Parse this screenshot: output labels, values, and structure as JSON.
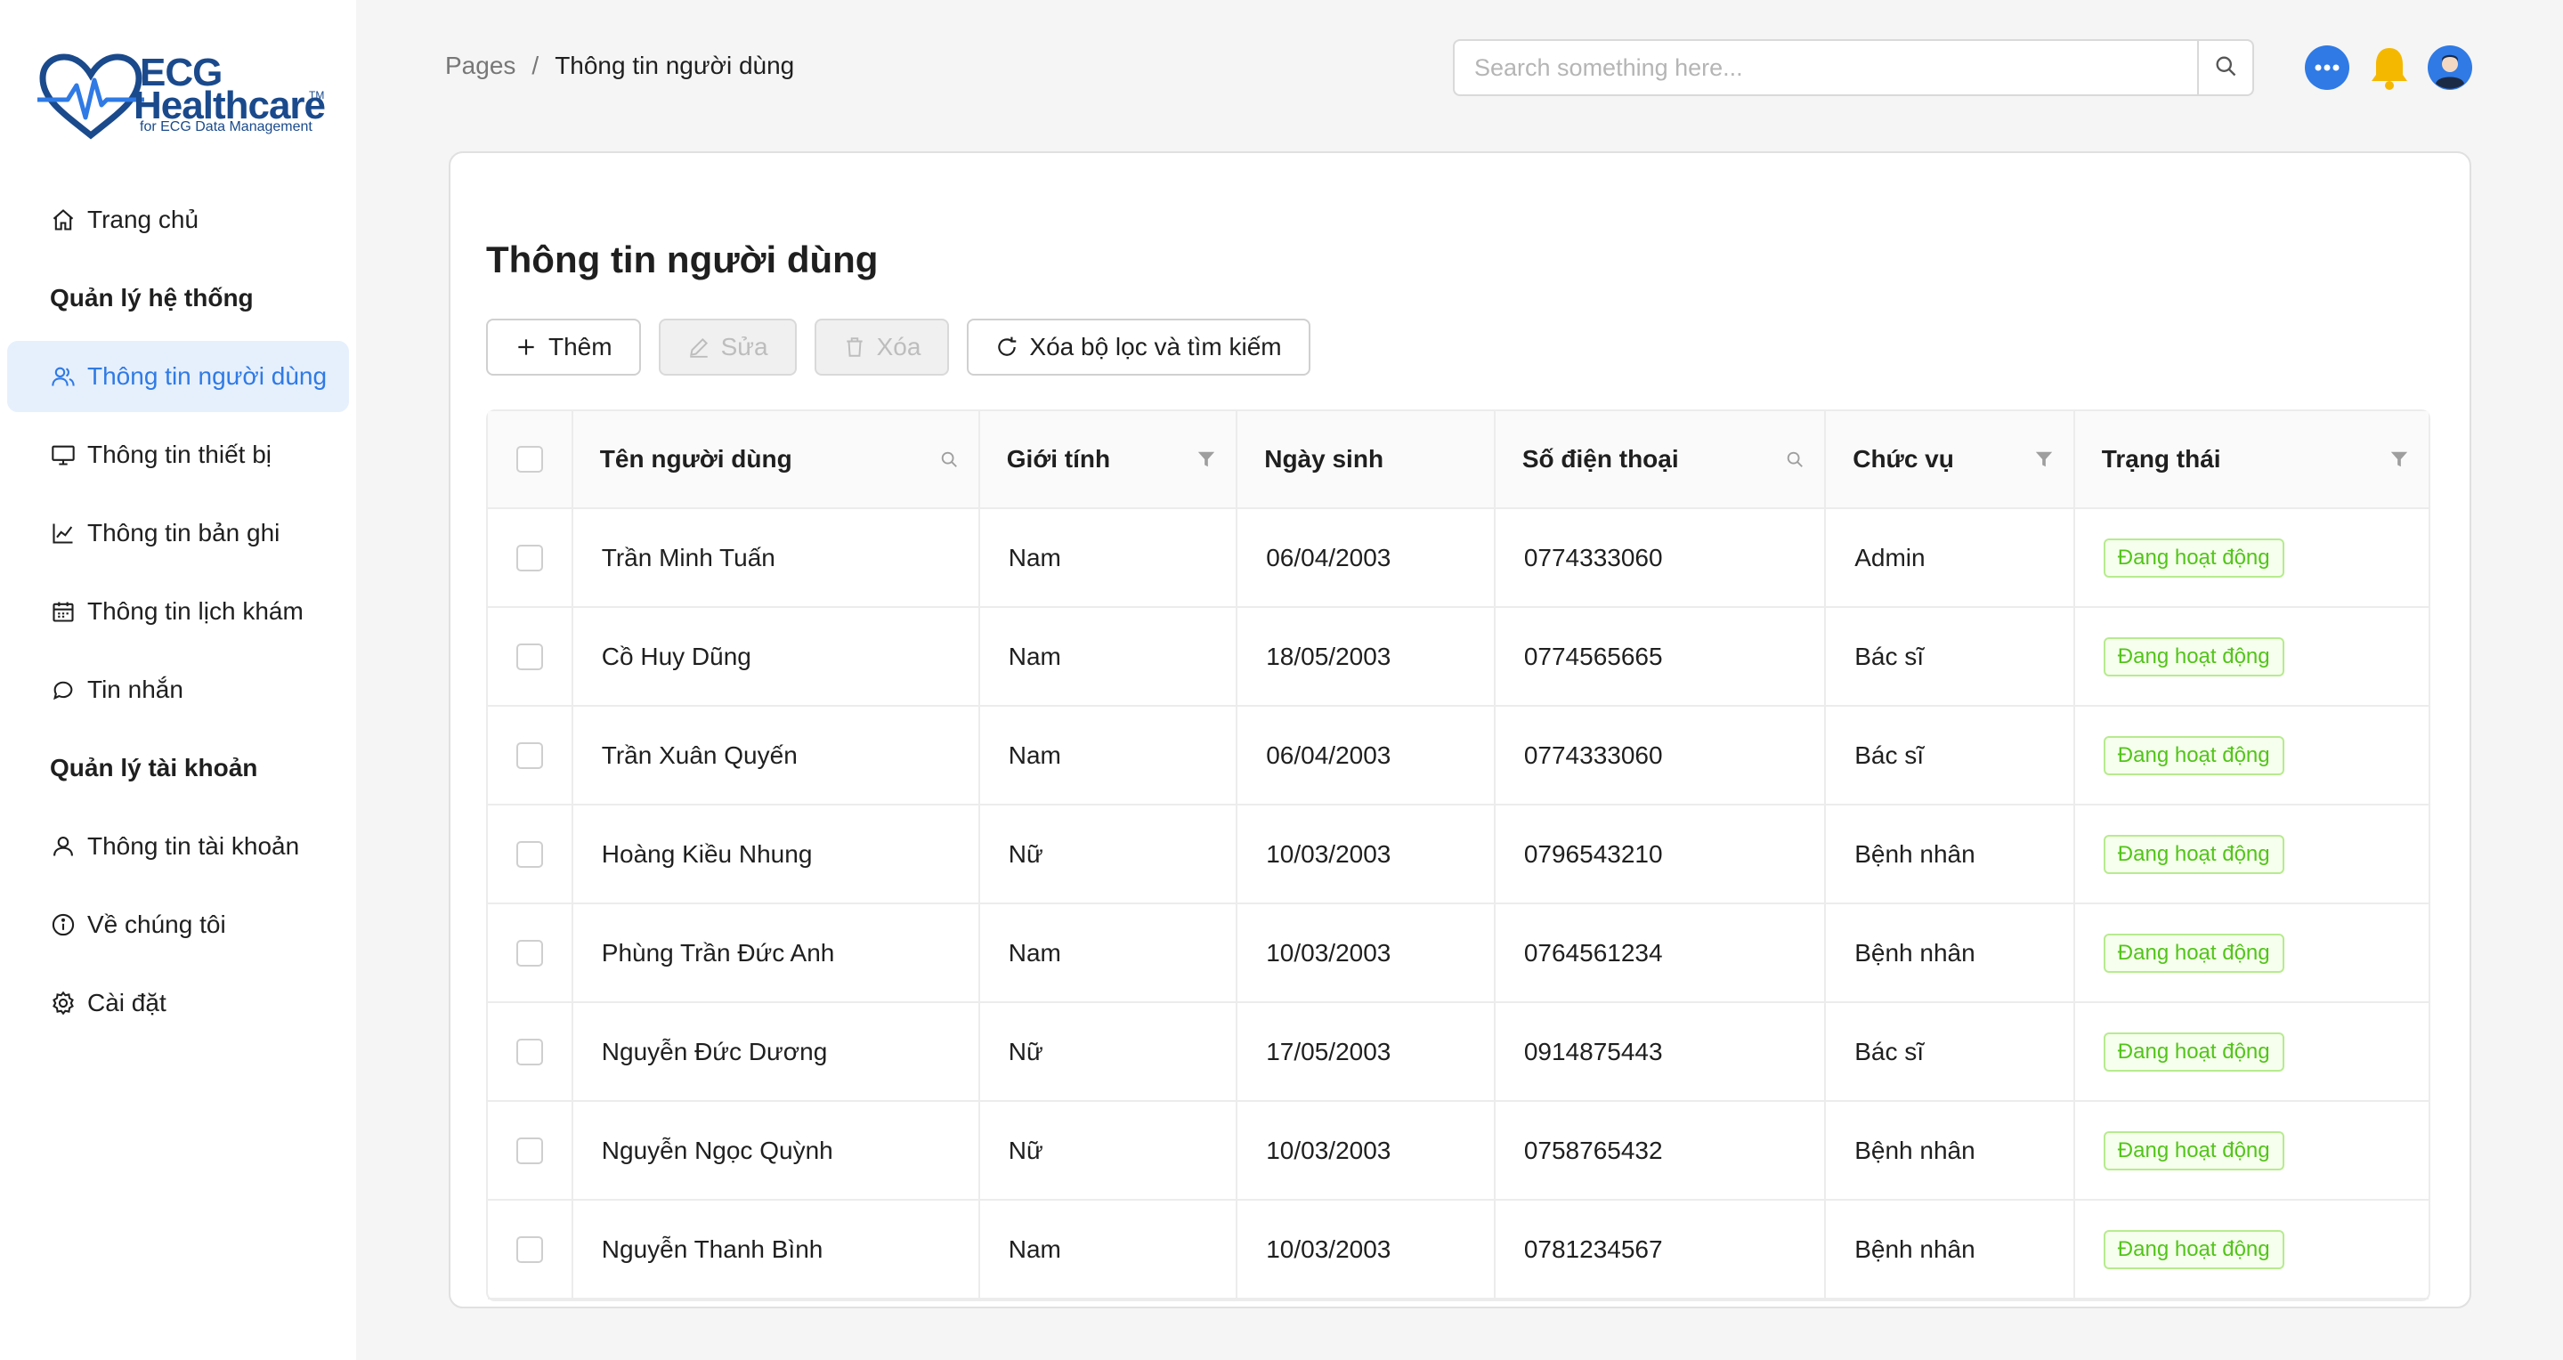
{
  "app": {
    "brand_line1": "ECG",
    "brand_line2": "Healthcare",
    "trademark": "TM",
    "tagline": "for ECG Data Management"
  },
  "sidebar": {
    "items": [
      {
        "label": "Trang chủ",
        "icon": "home-icon"
      },
      {
        "section": "Quản lý hệ thống"
      },
      {
        "label": "Thông tin người dùng",
        "icon": "users-icon",
        "active": true
      },
      {
        "label": "Thông tin thiết bị",
        "icon": "monitor-icon"
      },
      {
        "label": "Thông tin bản ghi",
        "icon": "line-chart-icon"
      },
      {
        "label": "Thông tin lịch khám",
        "icon": "calendar-icon"
      },
      {
        "label": "Tin nhắn",
        "icon": "chat-icon"
      },
      {
        "section": "Quản lý tài khoản"
      },
      {
        "label": "Thông tin tài khoản",
        "icon": "user-icon"
      },
      {
        "label": "Về chúng tôi",
        "icon": "info-icon"
      },
      {
        "label": "Cài đặt",
        "icon": "gear-icon"
      }
    ]
  },
  "header": {
    "breadcrumb_root": "Pages",
    "breadcrumb_sep": "/",
    "breadcrumb_current": "Thông tin người dùng",
    "search_placeholder": "Search something here..."
  },
  "colors": {
    "accent": "#2f7ae5",
    "active_bg": "#e6f0fd",
    "status_green": "#52c41a",
    "brand": "#1a4a8c"
  },
  "page": {
    "title": "Thông tin người dùng",
    "toolbar": {
      "add_label": "Thêm",
      "edit_label": "Sửa",
      "delete_label": "Xóa",
      "reset_label": "Xóa bộ lọc và tìm kiếm"
    }
  },
  "table": {
    "columns": [
      {
        "label": "Tên người dùng",
        "tool": "search-icon"
      },
      {
        "label": "Giới tính",
        "tool": "filter-icon"
      },
      {
        "label": "Ngày sinh",
        "tool": ""
      },
      {
        "label": "Số điện thoại",
        "tool": "search-icon"
      },
      {
        "label": "Chức vụ",
        "tool": "filter-icon"
      },
      {
        "label": "Trạng thái",
        "tool": "filter-icon"
      }
    ],
    "rows": [
      {
        "name": "Trần Minh Tuấn",
        "gender": "Nam",
        "dob": "06/04/2003",
        "phone": "0774333060",
        "role": "Admin",
        "status": "Đang hoạt động"
      },
      {
        "name": "Cồ Huy Dũng",
        "gender": "Nam",
        "dob": "18/05/2003",
        "phone": "0774565665",
        "role": "Bác sĩ",
        "status": "Đang hoạt động"
      },
      {
        "name": "Trần Xuân Quyến",
        "gender": "Nam",
        "dob": "06/04/2003",
        "phone": "0774333060",
        "role": "Bác sĩ",
        "status": "Đang hoạt động"
      },
      {
        "name": "Hoàng Kiều Nhung",
        "gender": "Nữ",
        "dob": "10/03/2003",
        "phone": "0796543210",
        "role": "Bệnh nhân",
        "status": "Đang hoạt động"
      },
      {
        "name": "Phùng Trần Đức Anh",
        "gender": "Nam",
        "dob": "10/03/2003",
        "phone": "0764561234",
        "role": "Bệnh nhân",
        "status": "Đang hoạt động"
      },
      {
        "name": "Nguyễn Đức Dương",
        "gender": "Nữ",
        "dob": "17/05/2003",
        "phone": "0914875443",
        "role": "Bác sĩ",
        "status": "Đang hoạt động"
      },
      {
        "name": "Nguyễn Ngọc Quỳnh",
        "gender": "Nữ",
        "dob": "10/03/2003",
        "phone": "0758765432",
        "role": "Bệnh nhân",
        "status": "Đang hoạt động"
      },
      {
        "name": "Nguyễn Thanh Bình",
        "gender": "Nam",
        "dob": "10/03/2003",
        "phone": "0781234567",
        "role": "Bệnh nhân",
        "status": "Đang hoạt động"
      }
    ]
  }
}
